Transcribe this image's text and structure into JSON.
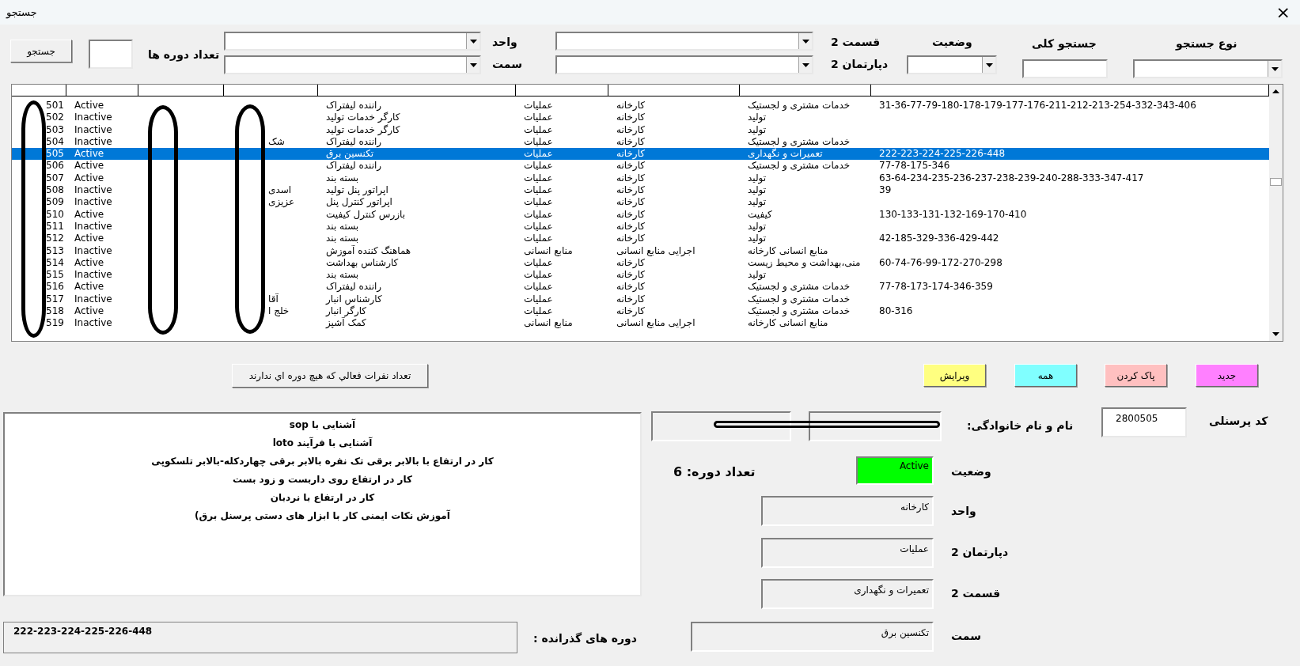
{
  "window": {
    "title": "جستجو",
    "close": "×"
  },
  "search": {
    "button": "جستجو",
    "course_count_label": "تعداد دوره ها",
    "unit_label": "واحد",
    "position_label": "سمت",
    "section_label": "قسمت 2",
    "department_label": "دپارتمان 2",
    "status_label": "وضعیت",
    "global_label": "جستجو کلی",
    "type_label": "نوع جستجو"
  },
  "table": {
    "rows": [
      {
        "id": "501",
        "status": "Active",
        "position": "راننده لیفتراک",
        "department": "عملیات",
        "unit": "کارخانه",
        "section": "خدمات مشتری و لجستیک",
        "courses": "31-36-77-79-180-178-179-177-176-211-212-213-254-332-343-406",
        "selected": false
      },
      {
        "id": "502",
        "status": "Inactive",
        "position": "کارگر خدمات تولید",
        "department": "عملیات",
        "unit": "کارخانه",
        "section": "تولید",
        "selected": false
      },
      {
        "id": "503",
        "status": "Inactive",
        "position": "کارگر خدمات تولید",
        "department": "عملیات",
        "unit": "کارخانه",
        "section": "تولید",
        "selected": false
      },
      {
        "id": "504",
        "status": "Inactive",
        "family": "شک",
        "position": "راننده لیفتراک",
        "department": "عملیات",
        "unit": "کارخانه",
        "section": "خدمات مشتری و لجستیک",
        "selected": false
      },
      {
        "id": "505",
        "status": "Active",
        "position": "تکنسین برق",
        "department": "عملیات",
        "unit": "کارخانه",
        "section": "تعمیرات و نگهداری",
        "courses": "222-223-224-225-226-448",
        "selected": true
      },
      {
        "id": "506",
        "status": "Active",
        "position": "راننده لیفتراک",
        "department": "عملیات",
        "unit": "کارخانه",
        "section": "خدمات مشتری و لجستیک",
        "courses": "77-78-175-346",
        "selected": false
      },
      {
        "id": "507",
        "status": "Active",
        "position": "بسته بند",
        "department": "عملیات",
        "unit": "کارخانه",
        "section": "تولید",
        "courses": "63-64-234-235-236-237-238-239-240-288-333-347-417",
        "selected": false
      },
      {
        "id": "508",
        "status": "Inactive",
        "family": "اسدی",
        "position": "اپراتور پنل تولید",
        "department": "عملیات",
        "unit": "کارخانه",
        "section": "تولید",
        "courses": "39",
        "selected": false
      },
      {
        "id": "509",
        "status": "Inactive",
        "family": "عزیزی",
        "position": "اپراتور کنترل پنل",
        "department": "عملیات",
        "unit": "کارخانه",
        "section": "تولید",
        "selected": false
      },
      {
        "id": "510",
        "status": "Active",
        "position": "بازرس کنترل کیفیت",
        "department": "عملیات",
        "unit": "کارخانه",
        "section": "کیفیت",
        "courses": "130-133-131-132-169-170-410",
        "selected": false
      },
      {
        "id": "511",
        "status": "Inactive",
        "position": "بسته بند",
        "department": "عملیات",
        "unit": "کارخانه",
        "section": "تولید",
        "selected": false
      },
      {
        "id": "512",
        "status": "Active",
        "position": "بسته بند",
        "department": "عملیات",
        "unit": "کارخانه",
        "section": "تولید",
        "courses": "42-185-329-336-429-442",
        "selected": false
      },
      {
        "id": "513",
        "status": "Inactive",
        "position": "هماهنگ کننده آموزش",
        "department": "منابع انسانی",
        "unit": "اجرایی منابع انسانی",
        "section": "منابع انسانی کارخانه",
        "selected": false
      },
      {
        "id": "514",
        "status": "Active",
        "position": "کارشناس بهداشت",
        "department": "عملیات",
        "unit": "کارخانه",
        "section": "منی،بهداشت و محیط زیست",
        "courses": "60-74-76-99-172-270-298",
        "selected": false
      },
      {
        "id": "515",
        "status": "Inactive",
        "position": "بسته بند",
        "department": "عملیات",
        "unit": "کارخانه",
        "section": "تولید",
        "selected": false
      },
      {
        "id": "516",
        "status": "Active",
        "position": "راننده لیفتراک",
        "department": "عملیات",
        "unit": "کارخانه",
        "section": "خدمات مشتری و لجستیک",
        "courses": "77-78-173-174-346-359",
        "selected": false
      },
      {
        "id": "517",
        "status": "Inactive",
        "family": "آقا",
        "position": "کارشناس انبار",
        "department": "عملیات",
        "unit": "کارخانه",
        "section": "خدمات مشتری و لجستیک",
        "selected": false
      },
      {
        "id": "518",
        "status": "Active",
        "family": "خلج ا",
        "position": "کارگر انبار",
        "department": "عملیات",
        "unit": "کارخانه",
        "section": "خدمات مشتری و لجستیک",
        "courses": "80-316",
        "selected": false
      },
      {
        "id": "519",
        "status": "Inactive",
        "position": "کمک آشپز",
        "department": "منابع انسانی",
        "unit": "اجرایی منابع انسانی",
        "section": "منابع انسانی کارخانه",
        "selected": false
      }
    ]
  },
  "actions": {
    "no_course_button": "تعداد نفرات فعالي كه هيچ دوره اي ندارند",
    "buttons": [
      {
        "label": "جدید",
        "color": "#ff80ff"
      },
      {
        "label": "پاک کردن",
        "color": "#ffc0c0"
      },
      {
        "label": "همه",
        "color": "#80ffff"
      },
      {
        "label": "ویرایش",
        "color": "#ffff80"
      }
    ]
  },
  "courses_list": [
    "آشنایی با sop",
    "آشنایی با فرآیند loto",
    "کار در ارتفاع با بالابر برقی تک نفره بالابر برقی چهاردکله-بالابر تلسکوپی",
    "کار در ارتفاع روی داربست و زود بست",
    "کار در ارتفاع با نردبان",
    "آموزش نکات ایمنی کار با ابزار های دستی پرسنل برق)"
  ],
  "passed": {
    "label": "دوره های گذرانده :",
    "value": "222-223-224-225-226-448"
  },
  "detail": {
    "name_label": "نام و نام خانوادگی:",
    "code_label": "کد پرسنلی",
    "code": "2800505",
    "status_label": "وضعیت",
    "status": "Active",
    "active": true,
    "course_count": "تعداد دوره: 6",
    "unit_label": "واحد",
    "unit": "کارخانه",
    "department_label": "دپارتمان 2",
    "department": "عملیات",
    "section_label": "قسمت 2",
    "section": "تعمیرات و نگهداری",
    "position_label": "سمت",
    "position": "تکنسین برق"
  }
}
